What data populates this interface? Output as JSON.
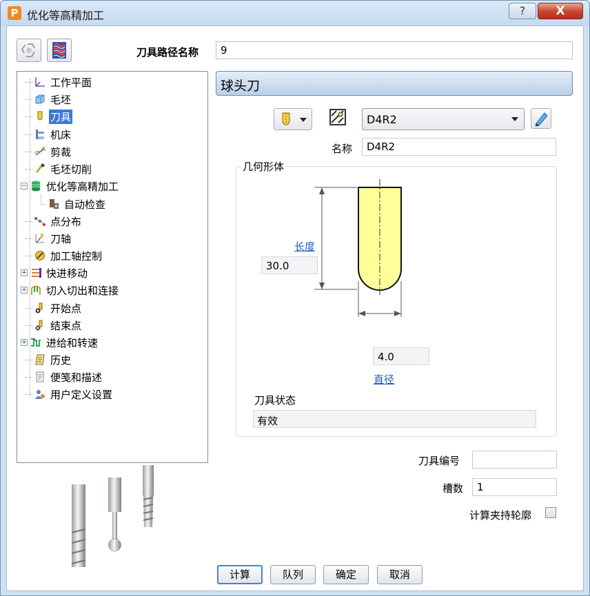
{
  "window": {
    "title": "优化等高精加工",
    "app_icon": "P",
    "help_label": "?",
    "close_label": "X"
  },
  "toolpath": {
    "name_label": "刀具路径名称",
    "name_value": "9"
  },
  "tree": [
    {
      "label": "工作平面",
      "icon": "workplane-icon"
    },
    {
      "label": "毛坯",
      "icon": "block-icon"
    },
    {
      "label": "刀具",
      "icon": "tool-icon",
      "selected": true
    },
    {
      "label": "机床",
      "icon": "machine-icon"
    },
    {
      "label": "剪裁",
      "icon": "trim-icon"
    },
    {
      "label": "毛坯切削",
      "icon": "stock-cut-icon"
    },
    {
      "label": "优化等高精加工",
      "icon": "strategy-icon",
      "expanded": true
    },
    {
      "label": "自动检查",
      "icon": "auto-check-icon",
      "child": true
    },
    {
      "label": "点分布",
      "icon": "point-distribution-icon"
    },
    {
      "label": "刀轴",
      "icon": "tool-axis-icon"
    },
    {
      "label": "加工轴控制",
      "icon": "axis-control-icon"
    },
    {
      "label": "快进移动",
      "icon": "rapid-move-icon",
      "collapsed": true
    },
    {
      "label": "切入切出和连接",
      "icon": "leads-links-icon",
      "collapsed": true
    },
    {
      "label": "开始点",
      "icon": "start-point-icon"
    },
    {
      "label": "结束点",
      "icon": "end-point-icon"
    },
    {
      "label": "进给和转速",
      "icon": "feeds-speeds-icon",
      "collapsed": true
    },
    {
      "label": "历史",
      "icon": "history-icon"
    },
    {
      "label": "便笺和描述",
      "icon": "notes-icon"
    },
    {
      "label": "用户定义设置",
      "icon": "user-settings-icon"
    }
  ],
  "tool": {
    "header": "球头刀",
    "selected_tool": "D4R2",
    "name_label": "名称",
    "name_value": "D4R2",
    "geometry_title": "几何形体",
    "length_label": "长度",
    "length_value": "30.0",
    "diameter_label": "直径",
    "diameter_value": "4.0",
    "status_label": "刀具状态",
    "status_value": "有效",
    "number_label": "刀具编号",
    "number_value": "",
    "flutes_label": "槽数",
    "flutes_value": "1",
    "holder_label": "计算夹持轮廓"
  },
  "colors": {
    "tool_fill": "#ffff99",
    "selected_bg": "#3a78d7",
    "link": "#1f5fb8"
  },
  "buttons": {
    "calculate": "计算",
    "queue": "队列",
    "ok": "确定",
    "cancel": "取消"
  }
}
